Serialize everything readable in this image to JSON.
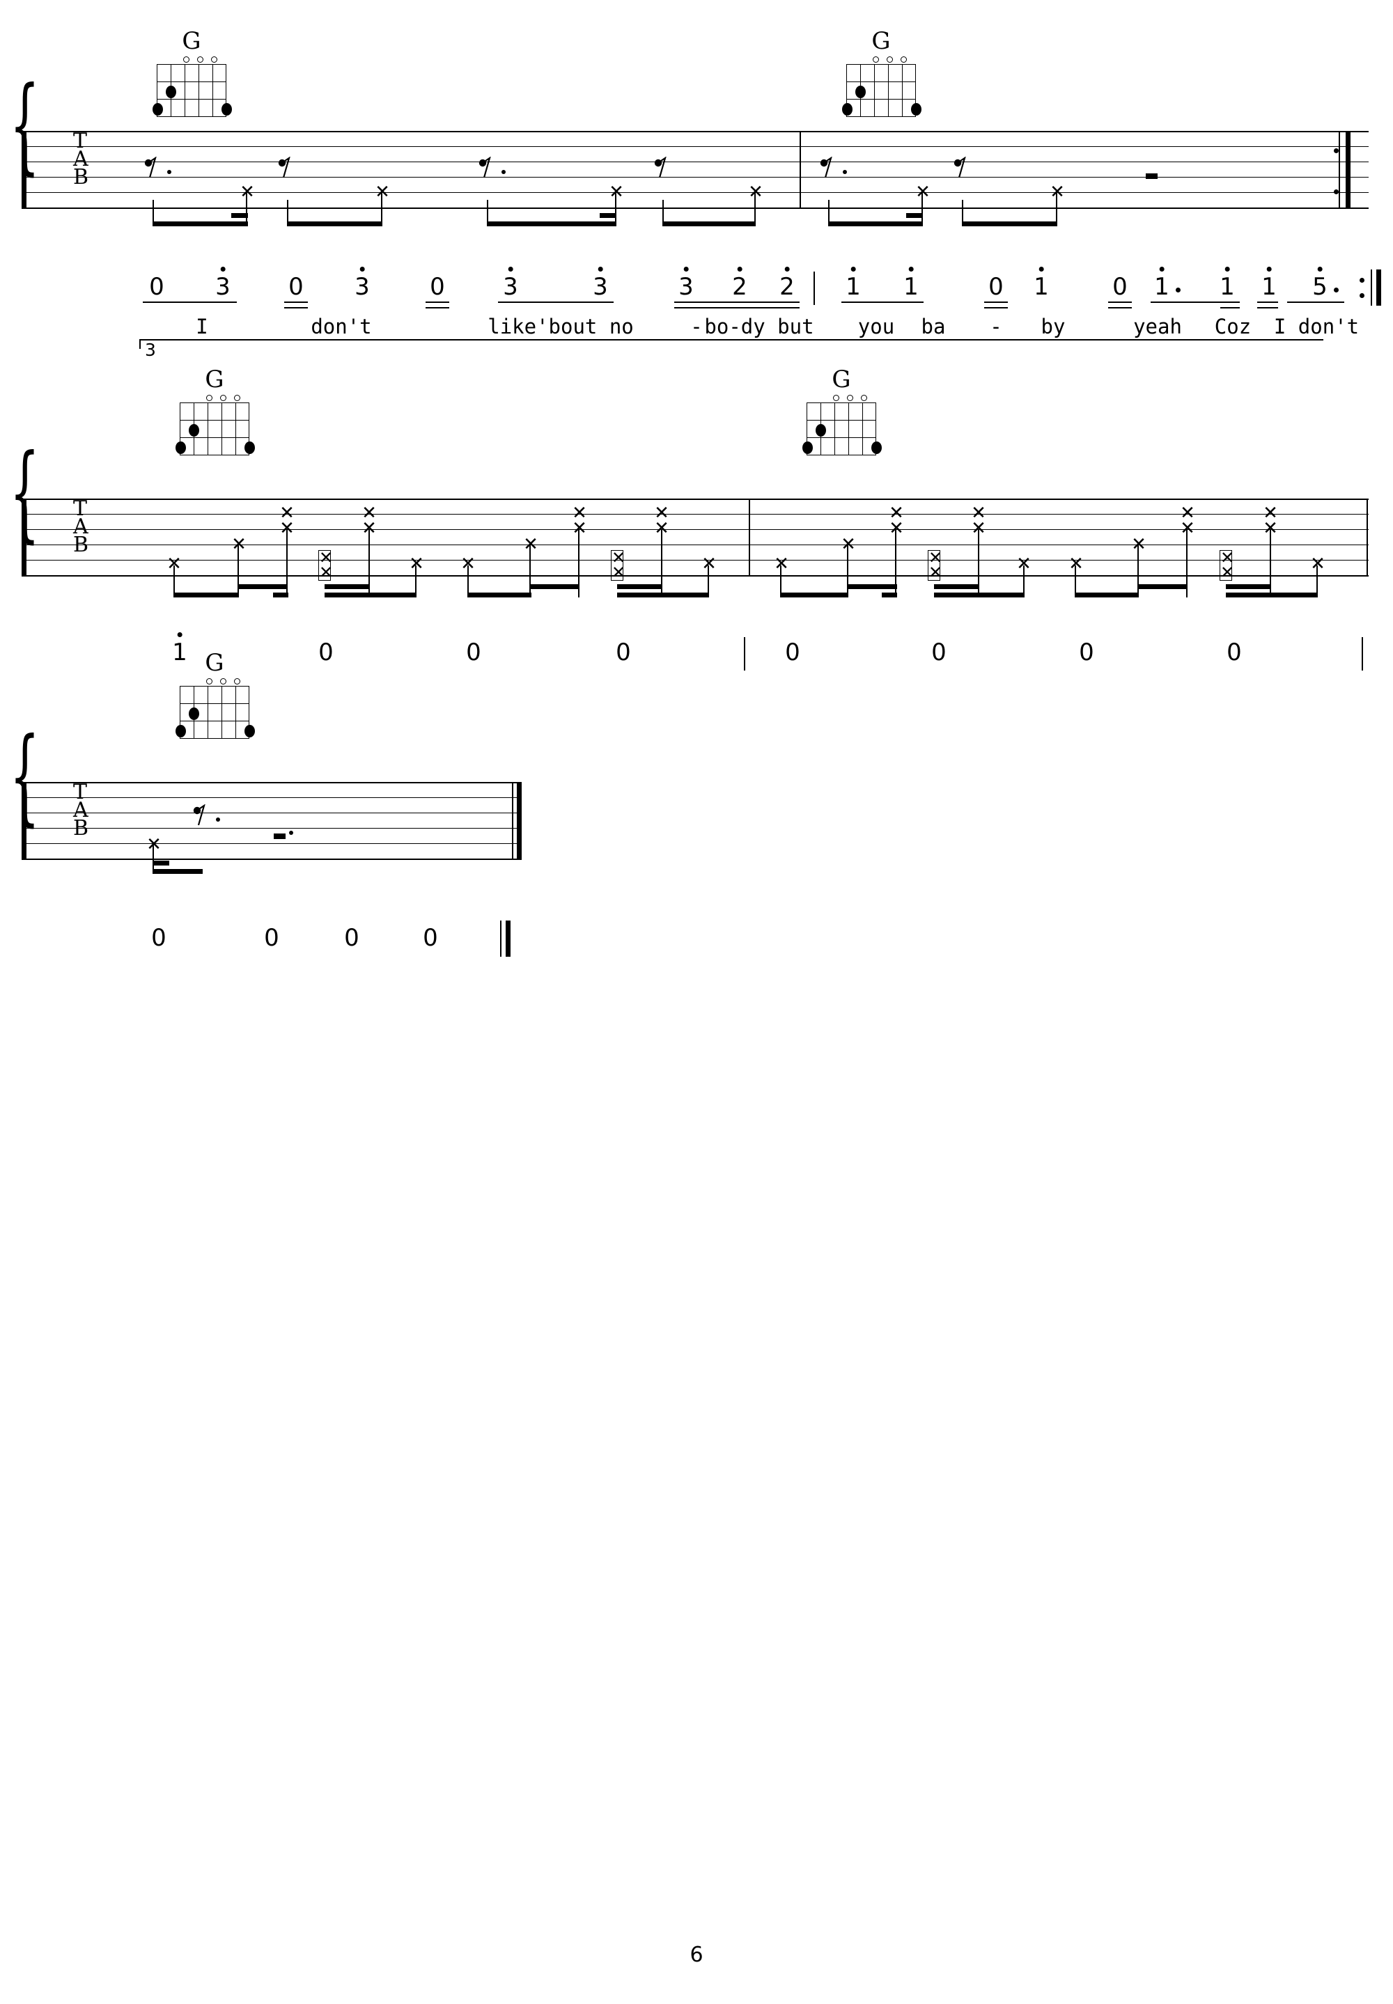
{
  "page": {
    "number": "6",
    "instrument_labels": [
      "T",
      "A",
      "B"
    ]
  },
  "chords": [
    {
      "name": "G",
      "system": 1,
      "measure": 1
    },
    {
      "name": "G",
      "system": 1,
      "measure": 2
    },
    {
      "name": "G",
      "system": 2,
      "measure": 1
    },
    {
      "name": "G",
      "system": 2,
      "measure": 2
    },
    {
      "name": "G",
      "system": 3,
      "measure": 1
    }
  ],
  "chord_diagram": {
    "name": "G",
    "open_strings": [
      3,
      4,
      5
    ],
    "fingered": [
      {
        "string": 1,
        "fret": 2
      },
      {
        "string": 0,
        "fret": 3
      },
      {
        "string": 5,
        "fret": 3
      }
    ]
  },
  "systems": [
    {
      "id": "system-1",
      "measures": 2,
      "jianpu": {
        "notes": [
          {
            "num": "0",
            "octave_up": false,
            "beams": 1,
            "dot": false
          },
          {
            "num": "3",
            "octave_up": true,
            "beams": 1,
            "dot": false
          },
          {
            "num": "0",
            "octave_up": false,
            "beams": 2,
            "dot": false
          },
          {
            "num": "3",
            "octave_up": true,
            "beams": 1,
            "dot": false
          },
          {
            "num": "0",
            "octave_up": false,
            "beams": 2,
            "dot": false
          },
          {
            "num": "3",
            "octave_up": true,
            "beams": 1,
            "dot": false
          },
          {
            "num": "3",
            "octave_up": true,
            "beams": 1,
            "dot": false
          },
          {
            "num": "3",
            "octave_up": true,
            "beams": 2,
            "dot": false
          },
          {
            "num": "2",
            "octave_up": true,
            "beams": 2,
            "dot": false
          },
          {
            "num": "2",
            "octave_up": true,
            "beams": 2,
            "dot": false
          },
          {
            "num": "1",
            "octave_up": true,
            "beams": 1,
            "dot": false
          },
          {
            "num": "1",
            "octave_up": true,
            "beams": 1,
            "dot": false
          },
          {
            "num": "0",
            "octave_up": false,
            "beams": 2,
            "dot": false
          },
          {
            "num": "1",
            "octave_up": true,
            "beams": 1,
            "dot": false
          },
          {
            "num": "0",
            "octave_up": false,
            "beams": 2,
            "dot": false
          },
          {
            "num": "1",
            "octave_up": true,
            "beams": 1,
            "dot": true
          },
          {
            "num": "1",
            "octave_up": true,
            "beams": 2,
            "dot": false
          },
          {
            "num": "1",
            "octave_up": true,
            "beams": 2,
            "dot": false
          },
          {
            "num": "5",
            "octave_up": true,
            "beams": 1,
            "dot": true
          }
        ],
        "end_repeat": true
      },
      "lyrics": [
        "I",
        "don't",
        "like'bout no",
        "-",
        "bo-dy but",
        "you",
        "ba",
        "-",
        "by",
        "yeah",
        "Coz",
        "I don't"
      ],
      "phrase_bracket_label": "3"
    },
    {
      "id": "system-2",
      "measures": 2,
      "jianpu": {
        "notes": [
          {
            "num": "1",
            "octave_up": true,
            "beams": 0,
            "dot": false
          },
          {
            "num": "0",
            "octave_up": false,
            "beams": 0,
            "dot": false
          },
          {
            "num": "0",
            "octave_up": false,
            "beams": 0,
            "dot": false
          },
          {
            "num": "0",
            "octave_up": false,
            "beams": 0,
            "dot": false
          },
          {
            "num": "0",
            "octave_up": false,
            "beams": 0,
            "dot": false
          },
          {
            "num": "0",
            "octave_up": false,
            "beams": 0,
            "dot": false
          },
          {
            "num": "0",
            "octave_up": false,
            "beams": 0,
            "dot": false
          },
          {
            "num": "0",
            "octave_up": false,
            "beams": 0,
            "dot": false
          }
        ],
        "end_repeat": false
      },
      "lyrics": []
    },
    {
      "id": "system-3",
      "measures": 1,
      "jianpu": {
        "notes": [
          {
            "num": "0",
            "octave_up": false,
            "beams": 0,
            "dot": false
          },
          {
            "num": "0",
            "octave_up": false,
            "beams": 0,
            "dot": false
          },
          {
            "num": "0",
            "octave_up": false,
            "beams": 0,
            "dot": false
          },
          {
            "num": "0",
            "octave_up": false,
            "beams": 0,
            "dot": false
          }
        ],
        "end_repeat": false
      },
      "lyrics": []
    }
  ]
}
